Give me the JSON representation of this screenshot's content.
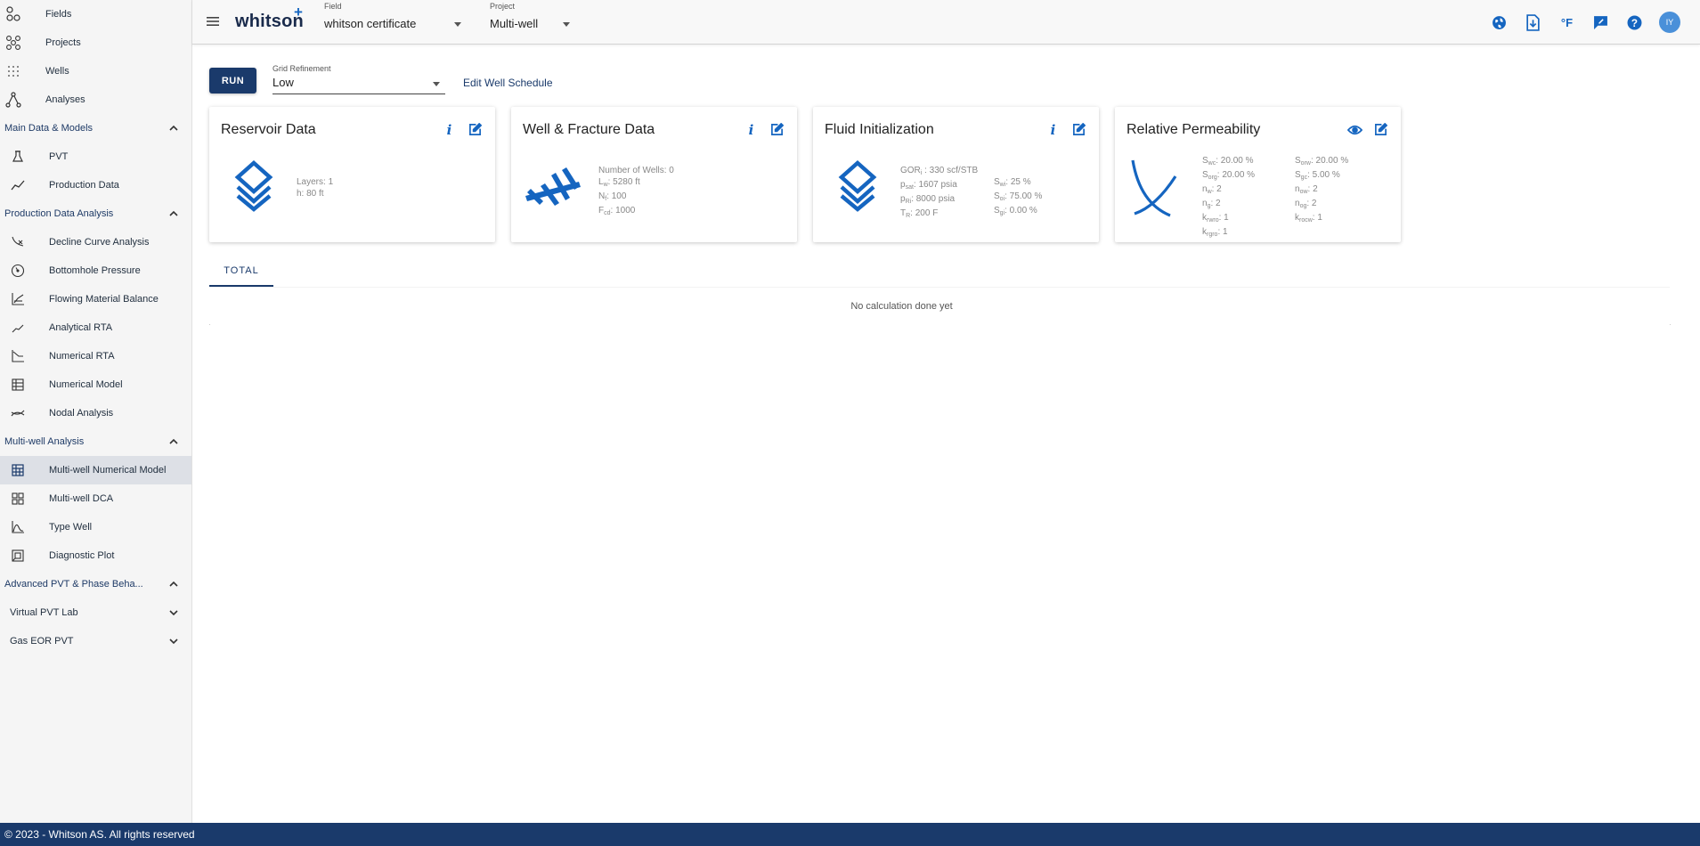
{
  "sidebar": {
    "top_items": [
      {
        "label": "Fields",
        "icon": "fields-icon"
      },
      {
        "label": "Projects",
        "icon": "projects-icon"
      },
      {
        "label": "Wells",
        "icon": "wells-icon"
      },
      {
        "label": "Analyses",
        "icon": "analyses-icon"
      }
    ],
    "sections": [
      {
        "title": "Main Data & Models",
        "items": [
          {
            "label": "PVT"
          },
          {
            "label": "Production Data"
          }
        ]
      },
      {
        "title": "Production Data Analysis",
        "items": [
          {
            "label": "Decline Curve Analysis"
          },
          {
            "label": "Bottomhole Pressure"
          },
          {
            "label": "Flowing Material Balance"
          },
          {
            "label": "Analytical RTA"
          },
          {
            "label": "Numerical RTA"
          },
          {
            "label": "Numerical Model"
          },
          {
            "label": "Nodal Analysis"
          }
        ]
      },
      {
        "title": "Multi-well Analysis",
        "items": [
          {
            "label": "Multi-well Numerical Model"
          },
          {
            "label": "Multi-well DCA"
          },
          {
            "label": "Type Well"
          },
          {
            "label": "Diagnostic Plot"
          }
        ]
      },
      {
        "title": "Advanced PVT & Phase Beha...",
        "items": [
          {
            "label": "Virtual PVT Lab"
          },
          {
            "label": "Gas EOR PVT"
          }
        ]
      }
    ]
  },
  "header": {
    "logo": "whitson",
    "logo_plus": "+",
    "field_caption": "Field",
    "field_value": "whitson certificate",
    "project_caption": "Project",
    "project_value": "Multi-well",
    "temp_unit": "°F",
    "avatar_initials": "IY"
  },
  "toolbar": {
    "run_label": "RUN",
    "grid_caption": "Grid Refinement",
    "grid_value": "Low",
    "edit_schedule_label": "Edit Well Schedule"
  },
  "cards": {
    "reservoir": {
      "title": "Reservoir Data",
      "layers": "Layers:  1",
      "h": "h:  80 ft"
    },
    "well": {
      "title": "Well & Fracture Data",
      "num_wells": "Number of Wells:  0",
      "lw_sym": "L",
      "lw_sub": "w",
      "lw_val": ":  5280 ft",
      "nf_sym": "N",
      "nf_sub": "f",
      "nf_val": ":  100",
      "fcd_sym": "F",
      "fcd_sub": "cd",
      "fcd_val": ":  1000"
    },
    "fluid": {
      "title": "Fluid Initialization",
      "gor_sym": "GOR",
      "gor_sub": "i",
      "gor_val": " :  330 scf/STB",
      "psat_sym": "p",
      "psat_sub": "sat",
      "psat_val": ":  1607 psia",
      "pri_sym": "p",
      "pri_sub": "Ri",
      "pri_val": ":  8000 psia",
      "tr_sym": "T",
      "tr_sub": "R",
      "tr_val": ":  200 F",
      "swi_sym": "S",
      "swi_sub": "wi",
      "swi_val": ":  25 %",
      "soi_sym": "S",
      "soi_sub": "oi",
      "soi_val": ":  75.00 %",
      "sgi_sym": "S",
      "sgi_sub": "gi",
      "sgi_val": ":  0.00 %"
    },
    "relperm": {
      "title": "Relative Permeability",
      "left": [
        {
          "sym": "S",
          "sub": "wc",
          "val": ":  20.00 %"
        },
        {
          "sym": "S",
          "sub": "org",
          "val": ":  20.00 %"
        },
        {
          "sym": "n",
          "sub": "w",
          "val": ":  2"
        },
        {
          "sym": "n",
          "sub": "g",
          "val": ":  2"
        },
        {
          "sym": "k",
          "sub": "rwro",
          "val": ":  1"
        },
        {
          "sym": "k",
          "sub": "rgro",
          "val": ":  1"
        }
      ],
      "right": [
        {
          "sym": "S",
          "sub": "orw",
          "val": ":  20.00 %"
        },
        {
          "sym": "S",
          "sub": "gc",
          "val": ":  5.00 %"
        },
        {
          "sym": "n",
          "sub": "ow",
          "val": ":  2"
        },
        {
          "sym": "n",
          "sub": "og",
          "val": ":  2"
        },
        {
          "sym": "k",
          "sub": "rocw",
          "val": ":  1"
        }
      ]
    }
  },
  "tabs": {
    "total_label": "TOTAL"
  },
  "results": {
    "empty_message": "No calculation done yet"
  },
  "footer": {
    "text": "© 2023 - Whitson AS. All rights reserved"
  },
  "colors": {
    "primary": "#1a3a6b",
    "accent": "#1565c0",
    "sidebar_bg": "#f5f5f5",
    "active_bg": "#dde0e6"
  }
}
